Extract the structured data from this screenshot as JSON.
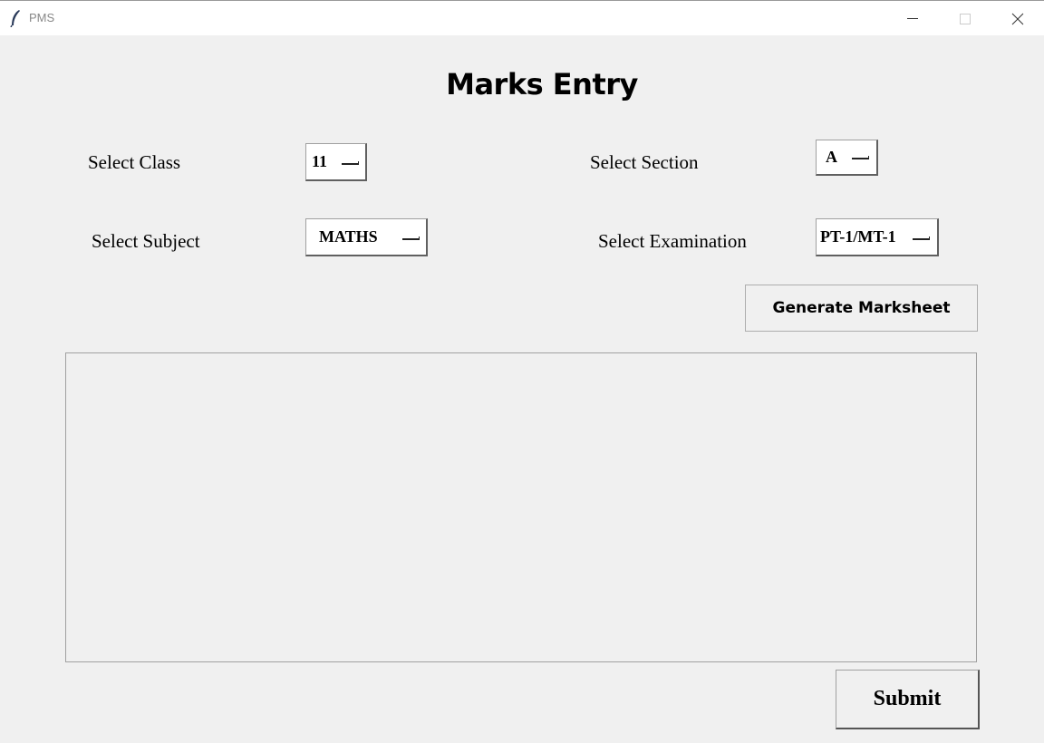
{
  "window": {
    "title": "PMS",
    "controls": [
      "minimize",
      "maximize",
      "close"
    ]
  },
  "heading": "Marks Entry",
  "form": {
    "class_label": "Select Class",
    "class_value": "11",
    "section_label": "Select Section",
    "section_value": "A",
    "subject_label": "Select Subject",
    "subject_value": "MATHS",
    "exam_label": "Select Examination",
    "exam_value": "PT-1/MT-1"
  },
  "buttons": {
    "generate": "Generate Marksheet",
    "submit": "Submit"
  },
  "marks_area": {
    "content": ""
  },
  "icons": {
    "app": "feather-icon",
    "minimize": "minimize-icon",
    "maximize": "maximize-icon",
    "close": "close-icon"
  },
  "colors": {
    "background": "#f0f0f0",
    "titlebar": "#ffffff"
  }
}
